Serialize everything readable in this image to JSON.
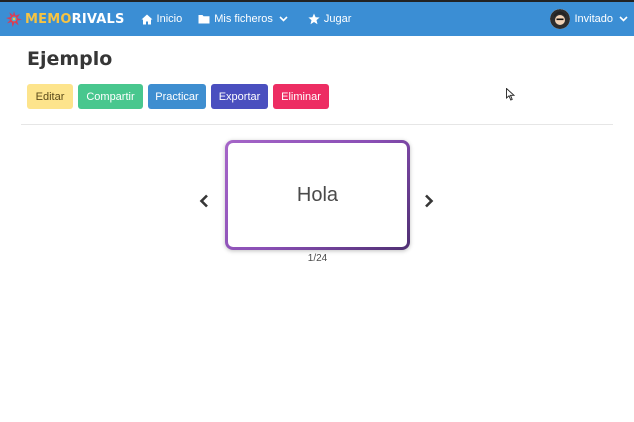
{
  "nav": {
    "brand_memo": "MEMO",
    "brand_rivals": "RIVALS",
    "home": "Inicio",
    "files": "Mis ficheros",
    "play": "Jugar",
    "user": "Invitado"
  },
  "page": {
    "title": "Ejemplo"
  },
  "toolbar": {
    "edit": "Editar",
    "share": "Compartir",
    "practice": "Practicar",
    "export": "Exportar",
    "delete": "Eliminar"
  },
  "card": {
    "text": "Hola",
    "counter": "1/24"
  },
  "colors": {
    "navbar": "#3b8ed4",
    "edit": "#fde48c",
    "share": "#48c78e",
    "practice": "#3e8ed0",
    "export": "#4a4fbf",
    "delete": "#ed2d63",
    "card_border": "#8a4fb5"
  },
  "icons": {
    "brand": "memorivals-logo-icon",
    "home": "home-icon",
    "files": "folder-icon",
    "play": "star-icon",
    "avatar": "user-avatar-icon"
  }
}
